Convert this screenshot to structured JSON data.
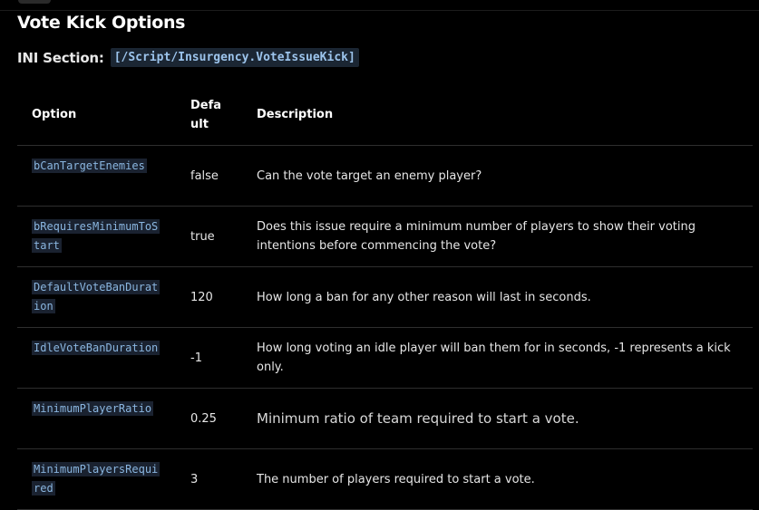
{
  "page": {
    "title": "Vote Kick Options",
    "ini_label": "INI Section:",
    "ini_section": "[/Script/Insurgency.VoteIssueKick]"
  },
  "table": {
    "headers": {
      "option": "Option",
      "default": "Defa ult",
      "description": "Description"
    },
    "rows": [
      {
        "option": "bCanTargetEnemies",
        "default": "false",
        "description": "Can the vote target an enemy player?"
      },
      {
        "option": "bRequiresMinimumToStart",
        "default": "true",
        "description": "Does this issue require a minimum number of players to show their voting intentions before commencing the vote?"
      },
      {
        "option": "DefaultVoteBanDuration",
        "default": "120",
        "description": "How long a ban for any other reason will last in seconds."
      },
      {
        "option": "IdleVoteBanDuration",
        "default": "-1",
        "description": "How long voting an idle player will ban them for in seconds, -1 represents a kick only."
      },
      {
        "option": "MinimumPlayerRatio",
        "default": "0.25",
        "description": "Minimum ratio of team required to start a vote."
      },
      {
        "option": "MinimumPlayersRequired",
        "default": "3",
        "description": "The number of players required to start a vote."
      }
    ]
  },
  "colors": {
    "background": "#000000",
    "code_background": "#1b2633",
    "code_text": "#9cc4ec",
    "row_divider": "#2e2e2e"
  }
}
